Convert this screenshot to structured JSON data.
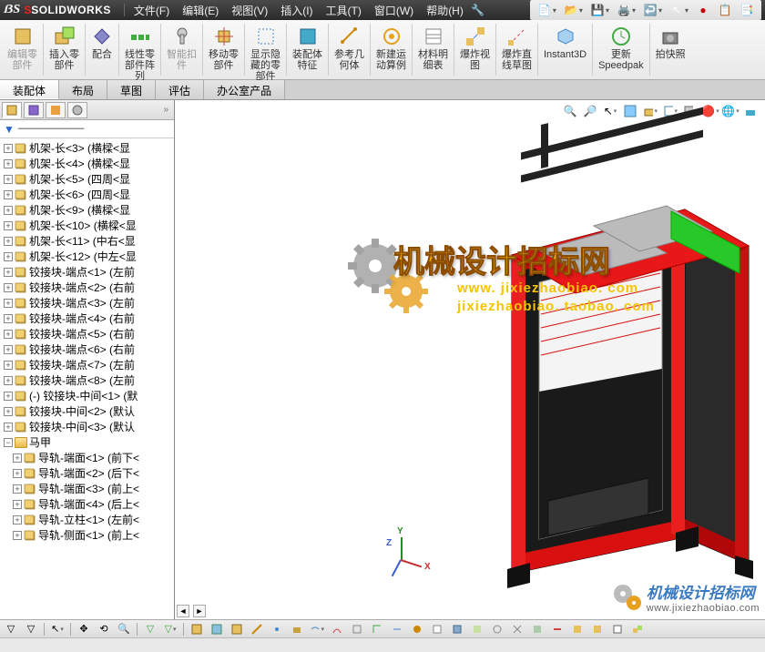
{
  "app": {
    "brand_prefix": "S",
    "brand": "SOLIDWORKS"
  },
  "menu": {
    "file": "文件(F)",
    "edit": "编辑(E)",
    "view": "视图(V)",
    "insert": "插入(I)",
    "tools": "工具(T)",
    "window": "窗口(W)",
    "help": "帮助(H)"
  },
  "ribbon": {
    "edit_comp": "编辑零\n部件",
    "insert_comp": "插入零\n部件",
    "mate": "配合",
    "linear_pattern": "线性零\n部件阵\n列",
    "smart_fastener": "智能扣\n件",
    "move_comp": "移动零\n部件",
    "show_hidden": "显示隐\n藏的零\n部件",
    "assembly_feat": "装配体\n特征",
    "ref_geom": "参考几\n何体",
    "motion_study": "新建运\n动算例",
    "bom": "材料明\n细表",
    "exploded": "爆炸视\n图",
    "explode_line": "爆炸直\n线草图",
    "instant3d": "Instant3D",
    "update_speedpak": "更新\nSpeedpak",
    "snapshot": "拍快照"
  },
  "tabs": {
    "assembly": "装配体",
    "layout": "布局",
    "sketch": "草图",
    "evaluate": "评估",
    "office": "办公室产品"
  },
  "tree": {
    "items": [
      {
        "exp": "+",
        "label": "机架-长<3> (横樑<显"
      },
      {
        "exp": "+",
        "label": "机架-长<4> (横樑<显"
      },
      {
        "exp": "+",
        "label": "机架-长<5> (四周<显"
      },
      {
        "exp": "+",
        "label": "机架-长<6> (四周<显"
      },
      {
        "exp": "+",
        "label": "机架-长<9> (横樑<显"
      },
      {
        "exp": "+",
        "label": "机架-长<10> (横樑<显"
      },
      {
        "exp": "+",
        "label": "机架-长<11> (中右<显"
      },
      {
        "exp": "+",
        "label": "机架-长<12> (中左<显"
      },
      {
        "exp": "+",
        "label": "铰接块-端点<1> (左前"
      },
      {
        "exp": "+",
        "label": "铰接块-端点<2> (右前"
      },
      {
        "exp": "+",
        "label": "铰接块-端点<3> (左前"
      },
      {
        "exp": "+",
        "label": "铰接块-端点<4> (右前"
      },
      {
        "exp": "+",
        "label": "铰接块-端点<5> (右前"
      },
      {
        "exp": "+",
        "label": "铰接块-端点<6> (右前"
      },
      {
        "exp": "+",
        "label": "铰接块-端点<7> (左前"
      },
      {
        "exp": "+",
        "label": "铰接块-端点<8> (左前"
      },
      {
        "exp": "+",
        "label": "(-) 铰接块-中间<1> (默"
      },
      {
        "exp": "+",
        "label": "铰接块-中间<2> (默认"
      },
      {
        "exp": "+",
        "label": "铰接块-中间<3> (默认"
      }
    ],
    "folder": "马甲",
    "items2": [
      {
        "exp": "+",
        "label": "导轨-端面<1> (前下<"
      },
      {
        "exp": "+",
        "label": "导轨-端面<2> (后下<"
      },
      {
        "exp": "+",
        "label": "导轨-端面<3> (前上<"
      },
      {
        "exp": "+",
        "label": "导轨-端面<4> (后上<"
      },
      {
        "exp": "+",
        "label": "导轨-立柱<1> (左前<"
      },
      {
        "exp": "+",
        "label": "导轨-侧面<1> (前上<"
      }
    ]
  },
  "triad": {
    "x": "X",
    "y": "Y",
    "z": "Z"
  },
  "watermark": {
    "main": "机械设计招标网",
    "url1": "www. jixiezhaobiao. com",
    "url2": "jixiezhaobiao. taobao. com",
    "corner_cn": "机械设计招标网",
    "corner_en": "www.jixiezhaobiao.com"
  }
}
